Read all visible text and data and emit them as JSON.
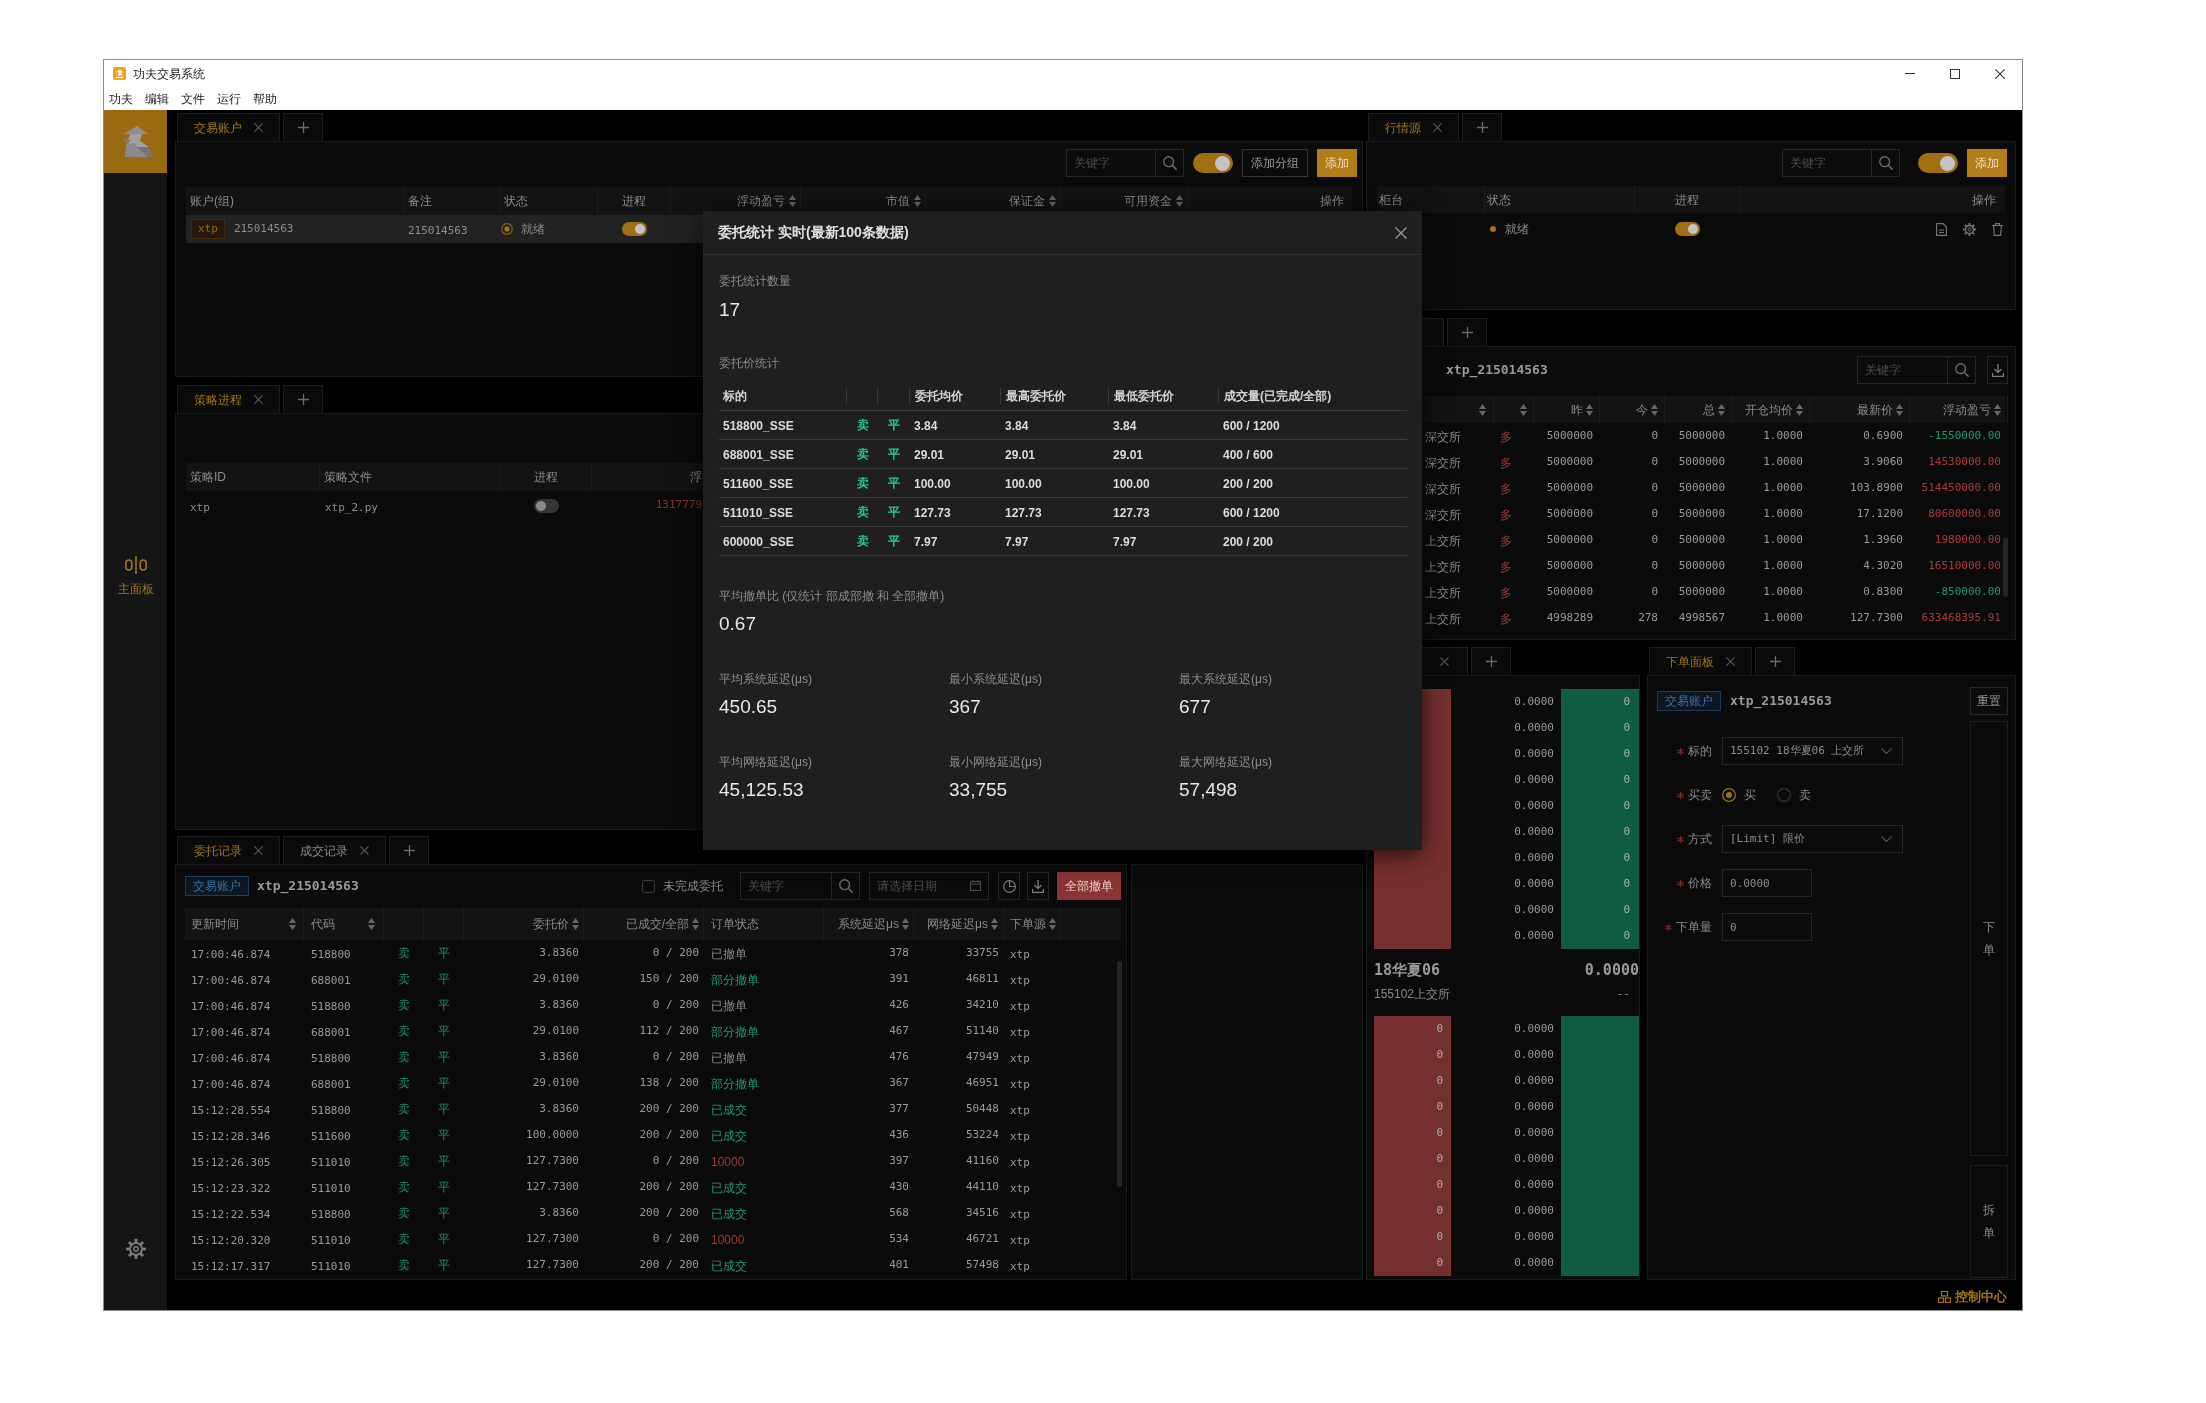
{
  "window": {
    "title": "功夫交易系统"
  },
  "menu": [
    "功夫",
    "编辑",
    "文件",
    "运行",
    "帮助"
  ],
  "sidebar": {
    "items": [
      {
        "label": "主面板",
        "selected": true
      }
    ]
  },
  "trading_accounts": {
    "tabs": [
      {
        "label": "交易账户",
        "selected": true
      }
    ],
    "search": {
      "placeholder": "关键字"
    },
    "toggle": {
      "on": true
    },
    "buttons": [
      {
        "label": "添加分组",
        "kind": "default"
      },
      {
        "label": "添加",
        "kind": "primary"
      }
    ],
    "columns": [
      {
        "label": "账户(组)",
        "sortable": false
      },
      {
        "label": "备注",
        "sortable": false
      },
      {
        "label": "状态",
        "sortable": false
      },
      {
        "label": "进程",
        "sortable": false
      },
      {
        "label": "浮动盈亏",
        "sortable": true
      },
      {
        "label": "市值",
        "sortable": true
      },
      {
        "label": "保证金",
        "sortable": true
      },
      {
        "label": "可用资金",
        "sortable": true
      },
      {
        "label": "操作",
        "sortable": false
      }
    ],
    "rows": [
      {
        "tag": "xtp",
        "account": "215014563",
        "note": "215014563",
        "status": "就绪",
        "process_on": true,
        "selected": true
      }
    ]
  },
  "strategies": {
    "tabs": [
      {
        "label": "策略进程",
        "selected": true
      }
    ],
    "columns": [
      "策略ID",
      "策略文件",
      "进程",
      "浮"
    ],
    "rows": [
      {
        "id": "xtp",
        "file": "xtp_2.py",
        "process_on": false,
        "column_4": "1317779"
      }
    ]
  },
  "order_records": {
    "tabs": [
      {
        "label": "委托记录",
        "selected": true
      },
      {
        "label": "成交记录",
        "selected": false
      }
    ],
    "account_tag": "交易账户",
    "account": "xtp_215014563",
    "unfinished_filter": {
      "label": "未完成委托",
      "checked": false
    },
    "search": {
      "placeholder": "关键字"
    },
    "date": {
      "placeholder": "请选择日期"
    },
    "cancel_all": "全部撤单",
    "columns": [
      {
        "label": "更新时间",
        "sortable": true
      },
      {
        "label": "代码",
        "sortable": true
      },
      {
        "label": "委托价",
        "sortable": true
      },
      {
        "label": "已成交/全部",
        "sortable": true
      },
      {
        "label": "订单状态",
        "sortable": false
      },
      {
        "label": "系统延迟μs",
        "sortable": true
      },
      {
        "label": "网络延迟μs",
        "sortable": true
      },
      {
        "label": "下单源",
        "sortable": true
      }
    ],
    "rows": [
      {
        "time": "17:00:46.874",
        "code": "518800",
        "side": "卖",
        "offset": "平",
        "price": "3.8360",
        "filled": "0 / 200",
        "status": "已撤单",
        "color": "#8a8a8a",
        "system_latency": "378",
        "network_latency": "33755",
        "source": "xtp"
      },
      {
        "time": "17:00:46.874",
        "code": "688001",
        "side": "卖",
        "offset": "平",
        "price": "29.0100",
        "filled": "150 / 200",
        "status": "部分撤单",
        "color": "#1f9a68",
        "system_latency": "391",
        "network_latency": "46811",
        "source": "xtp"
      },
      {
        "time": "17:00:46.874",
        "code": "518800",
        "side": "卖",
        "offset": "平",
        "price": "3.8360",
        "filled": "0 / 200",
        "status": "已撤单",
        "color": "#8a8a8a",
        "system_latency": "426",
        "network_latency": "34210",
        "source": "xtp"
      },
      {
        "time": "17:00:46.874",
        "code": "688001",
        "side": "卖",
        "offset": "平",
        "price": "29.0100",
        "filled": "112 / 200",
        "status": "部分撤单",
        "color": "#1f9a68",
        "system_latency": "467",
        "network_latency": "51140",
        "source": "xtp"
      },
      {
        "time": "17:00:46.874",
        "code": "518800",
        "side": "卖",
        "offset": "平",
        "price": "3.8360",
        "filled": "0 / 200",
        "status": "已撤单",
        "color": "#8a8a8a",
        "system_latency": "476",
        "network_latency": "47949",
        "source": "xtp"
      },
      {
        "time": "17:00:46.874",
        "code": "688001",
        "side": "卖",
        "offset": "平",
        "price": "29.0100",
        "filled": "138 / 200",
        "status": "部分撤单",
        "color": "#1f9a68",
        "system_latency": "367",
        "network_latency": "46951",
        "source": "xtp"
      },
      {
        "time": "15:12:28.554",
        "code": "518800",
        "side": "卖",
        "offset": "平",
        "price": "3.8360",
        "filled": "200 / 200",
        "status": "已成交",
        "color": "#1f9a68",
        "system_latency": "377",
        "network_latency": "50448",
        "source": "xtp"
      },
      {
        "time": "15:12:28.346",
        "code": "511600",
        "side": "卖",
        "offset": "平",
        "price": "100.0000",
        "filled": "200 / 200",
        "status": "已成交",
        "color": "#1f9a68",
        "system_latency": "436",
        "network_latency": "53224",
        "source": "xtp"
      },
      {
        "time": "15:12:26.305",
        "code": "511010",
        "side": "卖",
        "offset": "平",
        "price": "127.7300",
        "filled": "0 / 200",
        "status": "10000",
        "color": "#a33636",
        "system_latency": "397",
        "network_latency": "41160",
        "source": "xtp"
      },
      {
        "time": "15:12:23.322",
        "code": "511010",
        "side": "卖",
        "offset": "平",
        "price": "127.7300",
        "filled": "200 / 200",
        "status": "已成交",
        "color": "#1f9a68",
        "system_latency": "430",
        "network_latency": "44110",
        "source": "xtp"
      },
      {
        "time": "15:12:22.534",
        "code": "518800",
        "side": "卖",
        "offset": "平",
        "price": "3.8360",
        "filled": "200 / 200",
        "status": "已成交",
        "color": "#1f9a68",
        "system_latency": "568",
        "network_latency": "34516",
        "source": "xtp"
      },
      {
        "time": "15:12:20.320",
        "code": "511010",
        "side": "卖",
        "offset": "平",
        "price": "127.7300",
        "filled": "0 / 200",
        "status": "10000",
        "color": "#a33636",
        "system_latency": "534",
        "network_latency": "46721",
        "source": "xtp"
      },
      {
        "time": "15:12:17.317",
        "code": "511010",
        "side": "卖",
        "offset": "平",
        "price": "127.7300",
        "filled": "200 / 200",
        "status": "已成交",
        "color": "#1f9a68",
        "system_latency": "401",
        "network_latency": "57498",
        "source": "xtp"
      }
    ]
  },
  "market_sources": {
    "tabs": [
      {
        "label": "行情源",
        "selected": true
      }
    ],
    "search": {
      "placeholder": "关键字"
    },
    "toggle": {
      "on": true
    },
    "buttons": [
      {
        "label": "添加",
        "kind": "primary"
      }
    ],
    "columns": [
      "柜台",
      "状态",
      "进程",
      "操作"
    ],
    "rows": [
      {
        "status": "就绪",
        "process_on": true
      }
    ]
  },
  "positions": {
    "account": "xtp_215014563",
    "search": {
      "placeholder": "关键字"
    },
    "columns": [
      {
        "sortable": true
      },
      {
        "sortable": true
      },
      {
        "label": "昨",
        "sortable": true
      },
      {
        "label": "今",
        "sortable": true
      },
      {
        "label": "总",
        "sortable": true
      },
      {
        "label": "开仓均价",
        "sortable": true
      },
      {
        "label": "最新价",
        "sortable": true
      },
      {
        "label": "浮动盈亏",
        "sortable": true
      }
    ],
    "rows": [
      {
        "exchange": "深交所",
        "direction": "多",
        "yesterday": "5000000",
        "today": "0",
        "total": "5000000",
        "avg_open_price": "1.0000",
        "last_price": "0.6900",
        "pnl": "-1550000.00",
        "color": "#1f9a68"
      },
      {
        "exchange": "深交所",
        "direction": "多",
        "yesterday": "5000000",
        "today": "0",
        "total": "5000000",
        "avg_open_price": "1.0000",
        "last_price": "3.9060",
        "pnl": "14530000.00",
        "color": "#a83a3a"
      },
      {
        "exchange": "深交所",
        "direction": "多",
        "yesterday": "5000000",
        "today": "0",
        "total": "5000000",
        "avg_open_price": "1.0000",
        "last_price": "103.8900",
        "pnl": "514450000.00",
        "color": "#a83a3a"
      },
      {
        "exchange": "深交所",
        "direction": "多",
        "yesterday": "5000000",
        "today": "0",
        "total": "5000000",
        "avg_open_price": "1.0000",
        "last_price": "17.1200",
        "pnl": "80600000.00",
        "color": "#a83a3a"
      },
      {
        "exchange": "上交所",
        "direction": "多",
        "yesterday": "5000000",
        "today": "0",
        "total": "5000000",
        "avg_open_price": "1.0000",
        "last_price": "1.3960",
        "pnl": "1980000.00",
        "color": "#a83a3a"
      },
      {
        "exchange": "上交所",
        "direction": "多",
        "yesterday": "5000000",
        "today": "0",
        "total": "5000000",
        "avg_open_price": "1.0000",
        "last_price": "4.3020",
        "pnl": "16510000.00",
        "color": "#a83a3a"
      },
      {
        "exchange": "上交所",
        "direction": "多",
        "yesterday": "5000000",
        "today": "0",
        "total": "5000000",
        "avg_open_price": "1.0000",
        "last_price": "0.8300",
        "pnl": "-850000.00",
        "color": "#1f9a68"
      },
      {
        "exchange": "上交所",
        "direction": "多",
        "yesterday": "4998289",
        "today": "278",
        "total": "4998567",
        "avg_open_price": "1.0000",
        "last_price": "127.7300",
        "pnl": "633468395.91",
        "color": "#a83a3a"
      }
    ]
  },
  "order_book": {
    "asks": [
      {
        "price": "0.0000",
        "volume": "0"
      },
      {
        "price": "0.0000",
        "volume": "0"
      },
      {
        "price": "0.0000",
        "volume": "0"
      },
      {
        "price": "0.0000",
        "volume": "0"
      },
      {
        "price": "0.0000",
        "volume": "0"
      },
      {
        "price": "0.0000",
        "volume": "0"
      },
      {
        "price": "0.0000",
        "volume": "0"
      },
      {
        "price": "0.0000",
        "volume": "0"
      },
      {
        "price": "0.0000",
        "volume": "0"
      },
      {
        "price": "0.0000",
        "volume": "0"
      }
    ],
    "name": "18华夏06",
    "price": "0.0000",
    "code": "155102上交所",
    "change": "--",
    "bids": [
      {
        "volume": "0",
        "price": "0.0000"
      },
      {
        "volume": "0",
        "price": "0.0000"
      },
      {
        "volume": "0",
        "price": "0.0000"
      },
      {
        "volume": "0",
        "price": "0.0000"
      },
      {
        "volume": "0",
        "price": "0.0000"
      },
      {
        "volume": "0",
        "price": "0.0000"
      },
      {
        "volume": "0",
        "price": "0.0000"
      },
      {
        "volume": "0",
        "price": "0.0000"
      },
      {
        "volume": "0",
        "price": "0.0000"
      },
      {
        "volume": "0",
        "price": "0.0000"
      }
    ]
  },
  "order_panel": {
    "tabs": [
      {
        "label": "下单面板",
        "selected": true
      }
    ],
    "account_tag": "交易账户",
    "account": "xtp_215014563",
    "reset": "重置",
    "fields": [
      {
        "kind": "select",
        "label": "标的",
        "required": true,
        "value": "155102 18华夏06 上交所"
      },
      {
        "kind": "radio",
        "label": "买卖",
        "required": true,
        "options": [
          {
            "label": "买",
            "selected": true
          },
          {
            "label": "卖",
            "selected": false
          }
        ]
      },
      {
        "kind": "select",
        "label": "方式",
        "required": true,
        "value": "[Limit] 限价"
      },
      {
        "kind": "input",
        "label": "价格",
        "required": true,
        "value": "0.0000"
      },
      {
        "kind": "input",
        "label": "下单量",
        "required": true,
        "value": "0"
      }
    ],
    "submit": "下单",
    "split": "拆单"
  },
  "stats_modal": {
    "title": "委托统计 实时(最新100条数据)",
    "count_label": "委托统计数量",
    "count": "17",
    "price_stats_label": "委托价统计",
    "columns": [
      "标的",
      "委托均价",
      "最高委托价",
      "最低委托价",
      "成交量(已完成/全部)"
    ],
    "rows": [
      {
        "symbol": "518800_SSE",
        "side": "卖",
        "offset": "平",
        "avg_price": "3.84",
        "high_price": "3.84",
        "low_price": "3.84",
        "volume": "600 / 1200"
      },
      {
        "symbol": "688001_SSE",
        "side": "卖",
        "offset": "平",
        "avg_price": "29.01",
        "high_price": "29.01",
        "low_price": "29.01",
        "volume": "400 / 600"
      },
      {
        "symbol": "511600_SSE",
        "side": "卖",
        "offset": "平",
        "avg_price": "100.00",
        "high_price": "100.00",
        "low_price": "100.00",
        "volume": "200 / 200"
      },
      {
        "symbol": "511010_SSE",
        "side": "卖",
        "offset": "平",
        "avg_price": "127.73",
        "high_price": "127.73",
        "low_price": "127.73",
        "volume": "600 / 1200"
      },
      {
        "symbol": "600000_SSE",
        "side": "卖",
        "offset": "平",
        "avg_price": "7.97",
        "high_price": "7.97",
        "low_price": "7.97",
        "volume": "200 / 200"
      }
    ],
    "cancel_ratio_label": "平均撤单比 (仅统计 部成部撤 和 全部撤单)",
    "cancel_ratio": "0.67",
    "latency": [
      {
        "label": "平均系统延迟(μs)",
        "value": "450.65"
      },
      {
        "label": "最小系统延迟(μs)",
        "value": "367"
      },
      {
        "label": "最大系统延迟(μs)",
        "value": "677"
      },
      {
        "label": "平均网络延迟(μs)",
        "value": "45,125.53"
      },
      {
        "label": "最小网络延迟(μs)",
        "value": "33,755"
      },
      {
        "label": "最大网络延迟(μs)",
        "value": "57,498"
      }
    ]
  },
  "status_bar": {
    "label": "控制中心"
  }
}
